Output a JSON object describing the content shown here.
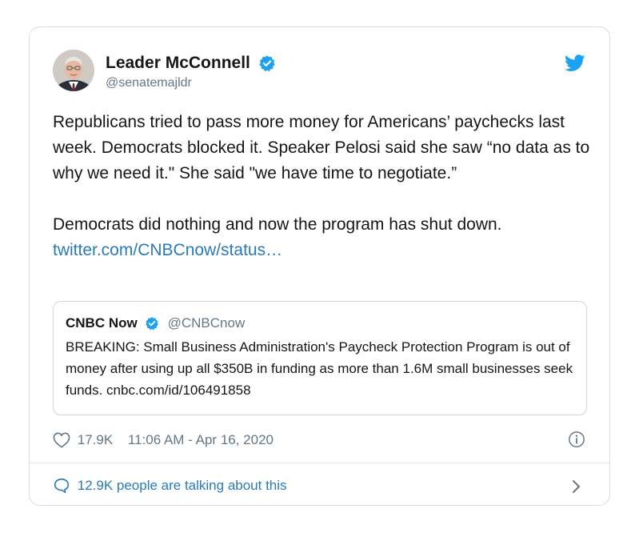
{
  "author": {
    "display_name": "Leader McConnell",
    "handle": "@senatemajldr",
    "verified": true,
    "avatar_icon": "avatar-portrait"
  },
  "brand": {
    "icon": "twitter-bird-icon",
    "color": "#1da1f2"
  },
  "tweet": {
    "paragraph_1": "Republicans tried to pass more money for Americans’ paychecks last week. Democrats blocked it. Speaker Pelosi said she saw “no data as to why we need it.\" She said \"we have time to negotiate.”",
    "paragraph_2": "Democrats did nothing and now the program has shut down.",
    "link_text": "twitter.com/CNBCnow/status…"
  },
  "quoted_tweet": {
    "display_name": "CNBC Now",
    "handle": "@CNBCnow",
    "verified": true,
    "text": "BREAKING: Small Business Administration's Paycheck Protection Program is out of money after using up all $350B in funding as more than 1.6M small businesses seek funds. cnbc.com/id/106491858"
  },
  "meta": {
    "likes": "17.9K",
    "timestamp": "11:06 AM - Apr 16, 2020",
    "like_icon": "heart-icon",
    "info_icon": "info-icon"
  },
  "footer": {
    "text": "12.9K people are talking about this",
    "icon": "comment-bubble-icon",
    "chevron_icon": "chevron-right-icon"
  },
  "colors": {
    "link": "#2b7bb9",
    "verified": "#1da1f2",
    "muted": "#657786",
    "border": "#d7dde2"
  }
}
